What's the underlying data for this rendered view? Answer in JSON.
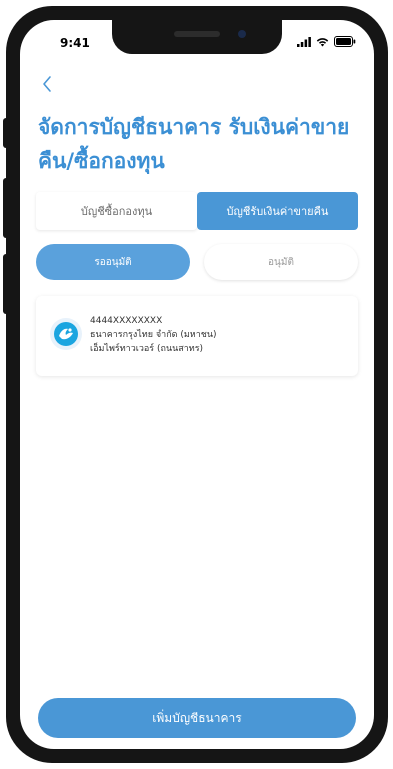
{
  "status_bar": {
    "time": "9:41"
  },
  "header": {
    "title": "จัดการบัญชีธนาคาร รับเงินค่าขายคืน/ซื้อกองทุน"
  },
  "tabs": [
    {
      "label": "บัญชีซื้อกองทุน",
      "active": false
    },
    {
      "label": "บัญชีรับเงินค่าขายคืน",
      "active": true
    }
  ],
  "status_tabs": [
    {
      "label": "รออนุมัติ",
      "active": true
    },
    {
      "label": "อนุมัติ",
      "active": false
    }
  ],
  "accounts": [
    {
      "number": "4444XXXXXXXX",
      "bank_name": "ธนาคารกรุงไทย จำกัด (มหาชน)",
      "branch": "เอ็มไพร์ทาวเวอร์ (ถนนสาทร)",
      "logo_icon": "krungthai-bank-icon"
    }
  ],
  "add_button_label": "เพิ่มบัญชีธนาคาร",
  "colors": {
    "accent": "#4a97d6",
    "title": "#3b8fd4"
  }
}
